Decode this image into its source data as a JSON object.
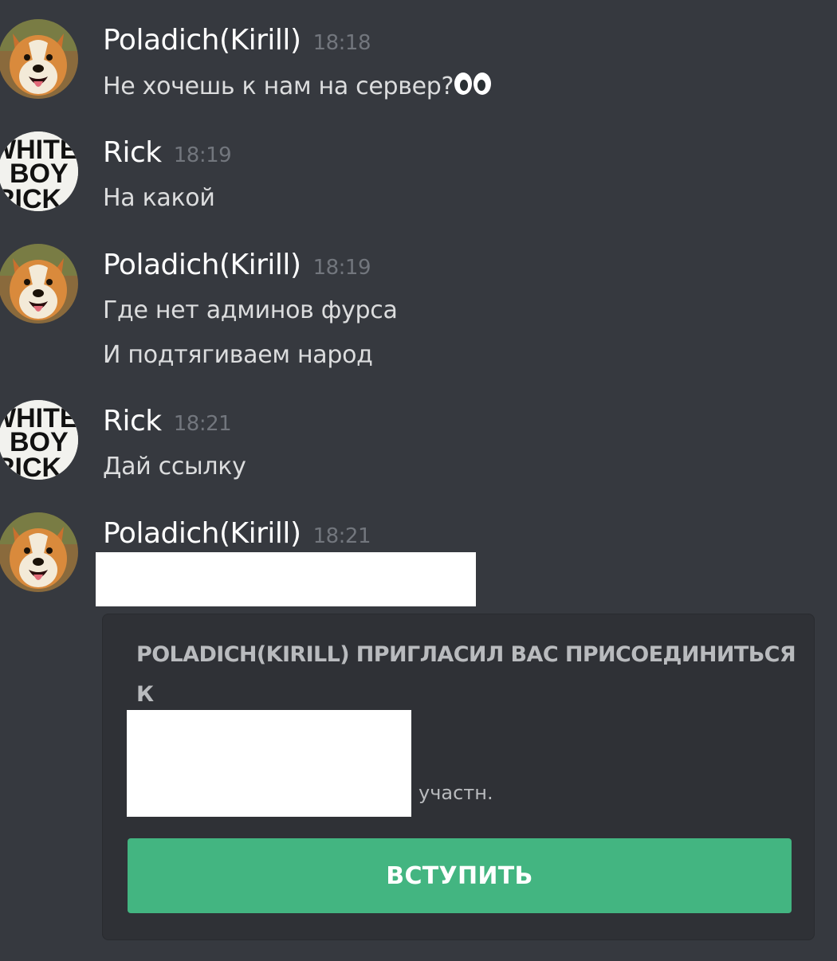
{
  "messages": [
    {
      "author": "Poladich(Kirill)",
      "time": "18:18",
      "lines": [
        "Не хочешь к нам на сервер?"
      ],
      "emoji": "eyes-icon"
    },
    {
      "author": "Rick",
      "time": "18:19",
      "lines": [
        "На какой"
      ],
      "avatar_text": [
        "WHITE",
        "BOY",
        "RICK"
      ]
    },
    {
      "author": "Poladich(Kirill)",
      "time": "18:19",
      "lines": [
        "Где нет админов фурса",
        "И подтягиваем народ"
      ]
    },
    {
      "author": "Rick",
      "time": "18:21",
      "lines": [
        "Дай ссылку"
      ],
      "avatar_text": [
        "WHITE",
        "BOY",
        "RICK"
      ]
    },
    {
      "author": "Poladich(Kirill)",
      "time": "18:21",
      "lines": []
    }
  ],
  "invite": {
    "title": "POLADICH(KIRILL) ПРИГЛАСИЛ ВАС ПРИСОЕДИНИТЬСЯ К",
    "members_suffix": "участн.",
    "join_label": "ВСТУПИТЬ",
    "join_color": "#43b581"
  },
  "colors": {
    "background": "#36393f",
    "card": "#2f3136",
    "username": "#ffffff",
    "timestamp": "#72767d",
    "text": "#dcddde"
  }
}
